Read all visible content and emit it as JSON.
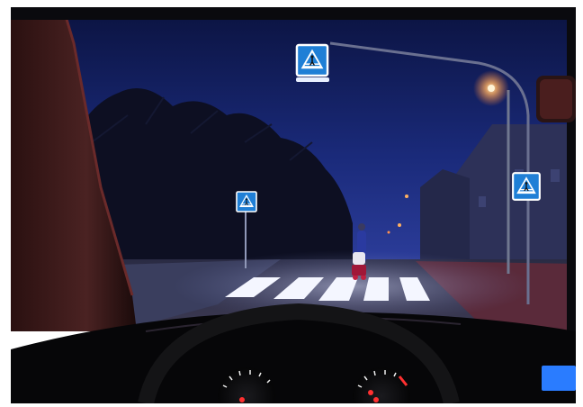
{
  "photo": {
    "subject": "",
    "colors": {
      "sky_top": "#0b1340",
      "sky_mid": "#1a2a7a",
      "sky_low": "#2e3f9e",
      "sign_blue": "#1f7fd6",
      "sign_white": "#ffffff",
      "street_lamp": "#ffb060",
      "crosswalk": "#f4f6ff",
      "dashboard": "#060608",
      "pillar": "#3a1a1a",
      "pavement_red": "#5a2a3a",
      "gauge_red": "#ff3030",
      "display_blue": "#2a7cff"
    },
    "icons": [
      "pedestrian-crossing-sign-icon"
    ]
  }
}
